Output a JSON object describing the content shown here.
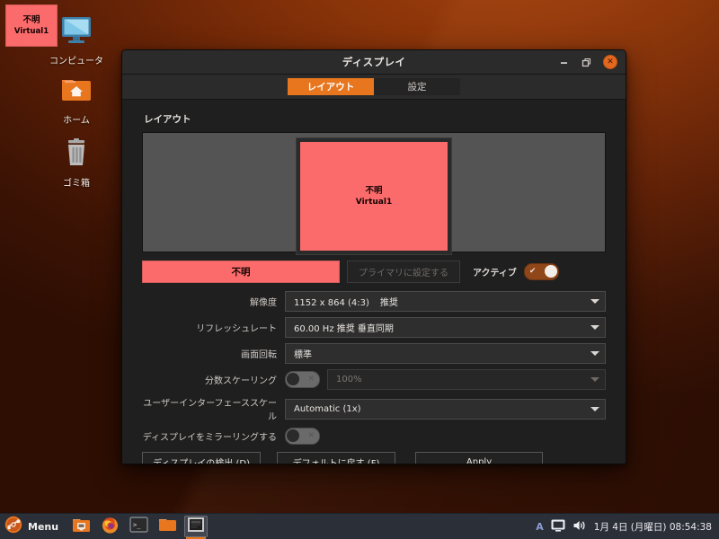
{
  "desktop": {
    "screen_id_overlay": {
      "name": "不明",
      "output": "Virtual1"
    },
    "icons": [
      {
        "id": "computer",
        "label": "コンピュータ",
        "icon": "computer-monitor-icon"
      },
      {
        "id": "home",
        "label": "ホーム",
        "icon": "home-folder-icon"
      },
      {
        "id": "trash",
        "label": "ゴミ箱",
        "icon": "trash-can-icon"
      }
    ]
  },
  "window": {
    "title": "ディスプレイ",
    "buttons": {
      "minimize": "minimize-icon",
      "maximize": "maximize-icon",
      "close": "close-icon"
    },
    "tabs": [
      {
        "id": "layout",
        "label": "レイアウト",
        "active": true
      },
      {
        "id": "settings",
        "label": "設定",
        "active": false
      }
    ],
    "section_title": "レイアウト",
    "preview": {
      "name": "不明",
      "output": "Virtual1",
      "color": "#fb6b6b"
    },
    "display_name": "不明",
    "set_primary_label": "プライマリに設定する",
    "active_label": "アクティブ",
    "active_toggle": "on",
    "fields": {
      "resolution": {
        "label": "解像度",
        "value": "1152 x 864 (4:3)",
        "suffix": "推奨"
      },
      "refresh_rate": {
        "label": "リフレッシュレート",
        "value": "60.00 Hz  推奨  垂直同期"
      },
      "rotation": {
        "label": "画面回転",
        "value": "標準"
      },
      "fractional_scaling": {
        "label": "分数スケーリング",
        "toggle": "off",
        "value": "100%",
        "disabled": true
      },
      "ui_scale": {
        "label": "ユーザーインターフェーススケール",
        "value": "Automatic (1x)"
      },
      "mirror_displays": {
        "label": "ディスプレイをミラーリングする",
        "toggle": "off"
      }
    },
    "buttons_row": {
      "detect": "ディスプレイの検出 (D)",
      "default": "デフォルトに戻す (F)",
      "apply": "Apply"
    }
  },
  "taskbar": {
    "menu_label": "Menu",
    "menu_icon": "ubuntu-mate-logo-icon",
    "tasks": [
      {
        "id": "files-orange",
        "icon": "file-manager-icon"
      },
      {
        "id": "firefox",
        "icon": "firefox-icon"
      },
      {
        "id": "terminal",
        "icon": "terminal-icon"
      },
      {
        "id": "folder",
        "icon": "folder-icon"
      },
      {
        "id": "display-settings",
        "icon": "display-window-icon",
        "active": true
      }
    ],
    "tray": {
      "ime": "A",
      "display_icon": "monitor-tray-icon",
      "volume_icon": "speaker-icon",
      "clock": "1月 4日 (月曜日) 08:54:38"
    }
  },
  "colors": {
    "accent": "#e8761f",
    "screen_pink": "#fb6b6b",
    "window_bg": "#1f1f1f",
    "taskbar_bg": "#2b2f38"
  }
}
